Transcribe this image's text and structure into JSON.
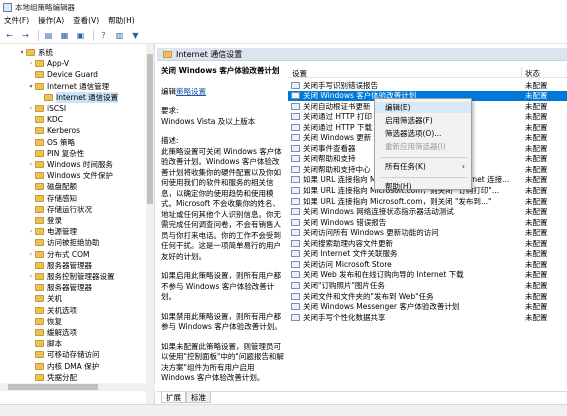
{
  "window": {
    "title": "本地组策略编辑器"
  },
  "menu": [
    "文件(F)",
    "操作(A)",
    "查看(V)",
    "帮助(H)"
  ],
  "toolbar": {
    "buttons": [
      {
        "name": "back-icon",
        "glyph": "←"
      },
      {
        "name": "forward-icon",
        "glyph": "→"
      },
      {
        "name": "up-folder-icon",
        "glyph": "▤"
      },
      {
        "name": "show-hide-tree-icon",
        "glyph": "▦"
      },
      {
        "name": "export-list-icon",
        "glyph": "▣"
      },
      {
        "name": "help-icon",
        "glyph": "?"
      },
      {
        "name": "properties-icon",
        "glyph": "▥"
      },
      {
        "name": "filter-icon",
        "glyph": "▼"
      }
    ]
  },
  "tree": {
    "items": [
      {
        "label": "系统",
        "expander": "▾",
        "indent": 2
      },
      {
        "label": "App-V",
        "expander": "›",
        "indent": 3
      },
      {
        "label": "Device Guard",
        "expander": "",
        "indent": 3
      },
      {
        "label": "Internet 通信管理",
        "expander": "▾",
        "indent": 3
      },
      {
        "label": "Internet 通信设置",
        "expander": "",
        "indent": 4,
        "selected": true
      },
      {
        "label": "iSCSI",
        "expander": "›",
        "indent": 3
      },
      {
        "label": "KDC",
        "expander": "",
        "indent": 3
      },
      {
        "label": "Kerberos",
        "expander": "",
        "indent": 3
      },
      {
        "label": "OS 策略",
        "expander": "",
        "indent": 3
      },
      {
        "label": "PIN 复杂性",
        "expander": "",
        "indent": 3
      },
      {
        "label": "Windows 时间服务",
        "expander": "›",
        "indent": 3
      },
      {
        "label": "Windows 文件保护",
        "expander": "",
        "indent": 3
      },
      {
        "label": "磁盘配额",
        "expander": "",
        "indent": 3
      },
      {
        "label": "存储感知",
        "expander": "",
        "indent": 3
      },
      {
        "label": "存储运行状况",
        "expander": "",
        "indent": 3
      },
      {
        "label": "登录",
        "expander": "",
        "indent": 3
      },
      {
        "label": "电源管理",
        "expander": "›",
        "indent": 3
      },
      {
        "label": "访问被拒绝协助",
        "expander": "",
        "indent": 3
      },
      {
        "label": "分布式 COM",
        "expander": "›",
        "indent": 3
      },
      {
        "label": "服务器管理器",
        "expander": "",
        "indent": 3
      },
      {
        "label": "服务控制管理器设置",
        "expander": "›",
        "indent": 3
      },
      {
        "label": "服务器管理器",
        "expander": "",
        "indent": 3
      },
      {
        "label": "关机",
        "expander": "",
        "indent": 3
      },
      {
        "label": "关机选项",
        "expander": "",
        "indent": 3
      },
      {
        "label": "恢复",
        "expander": "",
        "indent": 3
      },
      {
        "label": "缓解选项",
        "expander": "",
        "indent": 3
      },
      {
        "label": "脚本",
        "expander": "",
        "indent": 3
      },
      {
        "label": "可移动存储访问",
        "expander": "",
        "indent": 3
      },
      {
        "label": "内核 DMA 保护",
        "expander": "",
        "indent": 3
      },
      {
        "label": "凭据分配",
        "expander": "",
        "indent": 3
      }
    ]
  },
  "pane": {
    "header": "Internet 通信设置",
    "desc": {
      "policy_title": "关闭 Windows 客户体验改善计划",
      "edit_prefix": "编辑",
      "edit_link": "策略设置",
      "req_label": "要求:",
      "req_value": "Windows Vista 及以上版本",
      "desc_label": "描述:",
      "desc_text": "此策略设置可关闭 Windows 客户体验改善计划。Windows 客户体验改善计划将收集你的硬件配置以及你如何使用我们的软件和服务的相关信息，以确定你的使用趋势和使用模式。Microsoft 不会收集你的姓名、地址或任何其他个人识别信息。你无需完成任何调查问卷，不会有销售人员与你打来电话。你的工作不会受到任何干扰。这是一项简单易行的用户友好的计划。",
      "enabled_text": "如果启用此策略设置，则所有用户都不参与 Windows 客户体验改善计划。",
      "disabled_text": "如果禁用此策略设置，则所有用户都参与 Windows 客户体验改善计划。",
      "notconfig_text": "如果未配置此策略设置，则管理员可以使用\"控制面板\"中的\"问题报告和解决方案\"组件为所有用户启用 Windows 客户体验改善计划。"
    },
    "list": {
      "col_setting": "设置",
      "col_state": "状态",
      "rows": [
        {
          "name": "关闭手写识别错误报告",
          "state": "未配置"
        },
        {
          "name": "关闭 Windows 客户体验改善计划",
          "state": "未配置",
          "selected": true
        },
        {
          "name": "关闭自动根证书更新",
          "state": "未配置"
        },
        {
          "name": "关闭通过 HTTP 打印",
          "state": "未配置"
        },
        {
          "name": "关闭通过 HTTP 下载",
          "state": "未配置"
        },
        {
          "name": "关闭 Windows 更新",
          "state": "未配置"
        },
        {
          "name": "关闭事件查看器",
          "state": "未配置"
        },
        {
          "name": "关闭帮助和支持",
          "state": "未配置"
        },
        {
          "name": "关闭帮助和支持中心",
          "state": "未配置"
        },
        {
          "name": "如果 URL 连接指向 Microsoft.com，则关闭 Internet 连接...",
          "state": "未配置"
        },
        {
          "name": "如果 URL 连接指向 Microsoft.com，则关闭 \"订购打印\"...",
          "state": "未配置"
        },
        {
          "name": "如果 URL 连接指向 Microsoft.com，则关闭 \"发布到...\"",
          "state": "未配置"
        },
        {
          "name": "关闭 Windows 网络连接状态指示器活动测试",
          "state": "未配置"
        },
        {
          "name": "关闭 Windows 错误报告",
          "state": "未配置"
        },
        {
          "name": "关闭访问所有 Windows 更新功能的访问",
          "state": "未配置"
        },
        {
          "name": "关闭搜索助理内容文件更新",
          "state": "未配置"
        },
        {
          "name": "关闭 Internet 文件关联服务",
          "state": "未配置"
        },
        {
          "name": "关闭访问 Microsoft Store",
          "state": "未配置"
        },
        {
          "name": "关闭 Web 发布和在线订购向导的 Internet 下载",
          "state": "未配置"
        },
        {
          "name": "关闭\"订购照片\"图片任务",
          "state": "未配置"
        },
        {
          "name": "关闭文件和文件夹的\"发布到 Web\"任务",
          "state": "未配置"
        },
        {
          "name": "关闭 Windows Messenger 客户体验改善计划",
          "state": "未配置"
        },
        {
          "name": "关闭手写个性化数据共享",
          "state": "未配置"
        }
      ]
    }
  },
  "context_menu": {
    "items": [
      {
        "label": "编辑(E)",
        "highlight": true
      },
      {
        "label": "启用筛选器(F)"
      },
      {
        "label": "筛选器选项(O)..."
      },
      {
        "label": "重新应用筛选器(I)",
        "disabled": true
      },
      {
        "sep": true
      },
      {
        "label": "所有任务(K)",
        "submenu": true
      },
      {
        "sep": true
      },
      {
        "label": "帮助(H)"
      }
    ]
  },
  "tabs": [
    "扩展",
    "标准"
  ]
}
